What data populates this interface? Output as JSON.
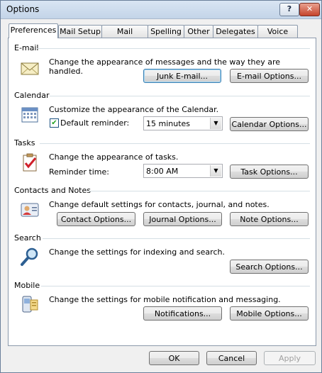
{
  "window": {
    "title": "Options",
    "help": "?",
    "close": "✕"
  },
  "tabs": [
    "Preferences",
    "Mail Setup",
    "Mail Format",
    "Spelling",
    "Other",
    "Delegates",
    "Voice Mail"
  ],
  "email": {
    "heading": "E-mail",
    "desc": "Change the appearance of messages and the way they are handled.",
    "junk_button": "Junk E-mail...",
    "options_button": "E-mail Options..."
  },
  "calendar": {
    "heading": "Calendar",
    "desc": "Customize the appearance of the Calendar.",
    "reminder_label": "Default reminder:",
    "reminder_checked": "✔",
    "reminder_value": "15 minutes",
    "options_button": "Calendar Options..."
  },
  "tasks": {
    "heading": "Tasks",
    "desc": "Change the appearance of tasks.",
    "reminder_label": "Reminder time:",
    "reminder_value": "8:00 AM",
    "options_button": "Task Options..."
  },
  "contacts": {
    "heading": "Contacts and Notes",
    "desc": "Change default settings for contacts, journal, and notes.",
    "contact_button": "Contact Options...",
    "journal_button": "Journal Options...",
    "note_button": "Note Options..."
  },
  "search": {
    "heading": "Search",
    "desc": "Change the settings for indexing and search.",
    "options_button": "Search Options..."
  },
  "mobile": {
    "heading": "Mobile",
    "desc": "Change the settings for mobile notification and messaging.",
    "notifications_button": "Notifications...",
    "options_button": "Mobile Options..."
  },
  "footer": {
    "ok": "OK",
    "cancel": "Cancel",
    "apply": "Apply"
  }
}
